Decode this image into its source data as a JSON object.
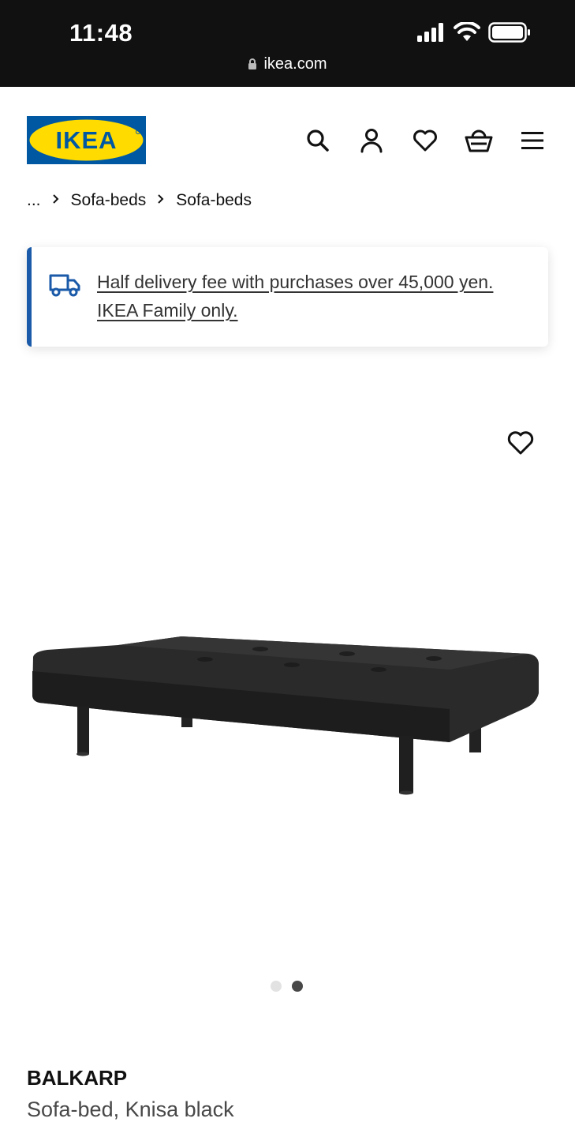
{
  "status_bar": {
    "time": "11:48",
    "url": "ikea.com"
  },
  "header": {
    "logo_text": "IKEA",
    "icons": [
      "search-icon",
      "user-icon",
      "heart-icon",
      "basket-icon",
      "menu-icon"
    ]
  },
  "breadcrumb": {
    "ellipsis": "...",
    "items": [
      "Sofa-beds",
      "Sofa-beds"
    ]
  },
  "banner": {
    "message": "Half delivery fee with purchases over 45,000 yen. IKEA Family only."
  },
  "carousel": {
    "count": 2,
    "active_index": 1
  },
  "product": {
    "name": "BALKARP",
    "description": "Sofa-bed, Knisa black"
  },
  "colors": {
    "ikea_blue": "#0058a3",
    "ikea_yellow": "#ffdb00",
    "banner_accent": "#1a5aa8"
  }
}
